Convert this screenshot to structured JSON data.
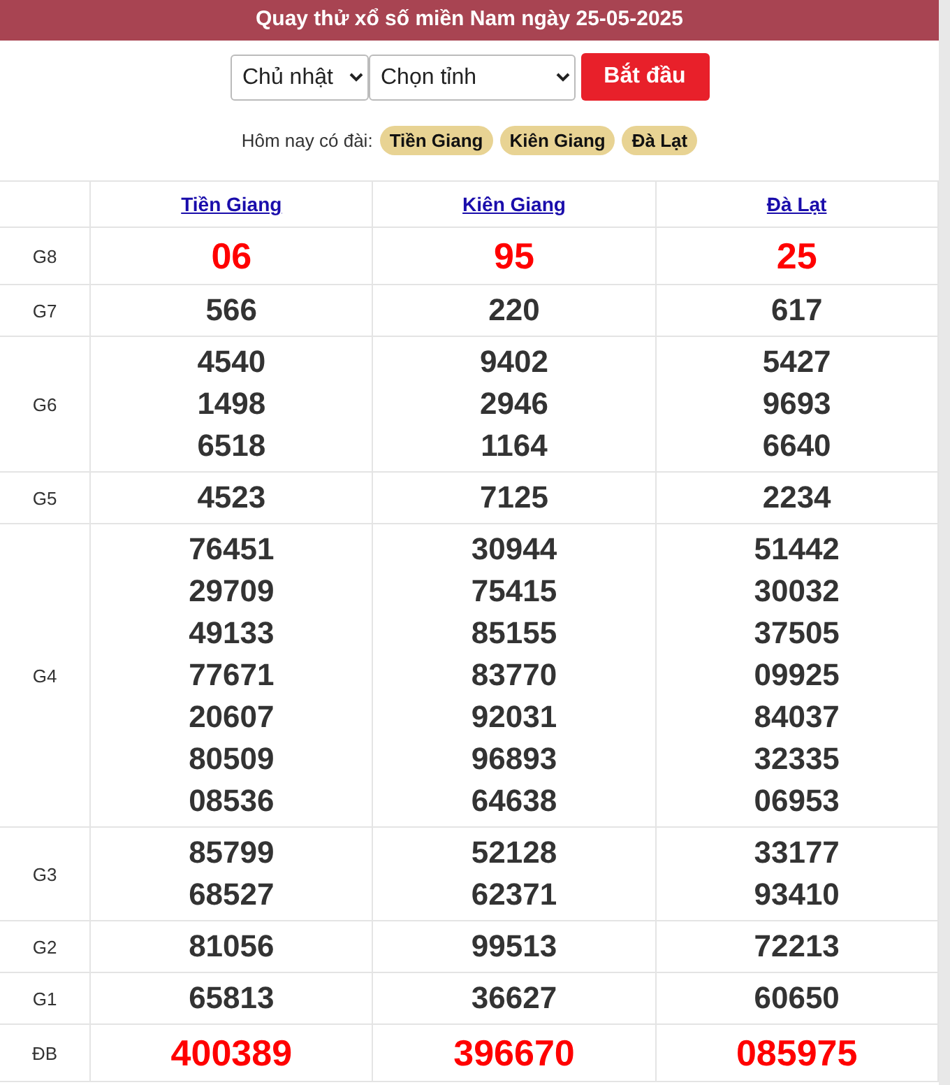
{
  "title": "Quay thử xổ số miền Nam ngày 25-05-2025",
  "controls": {
    "day": "Chủ nhật",
    "province": "Chọn tỉnh",
    "start_button": "Bắt đầu"
  },
  "today": {
    "label": "Hôm nay có đài:",
    "stations": [
      "Tiền Giang",
      "Kiên Giang",
      "Đà Lạt"
    ]
  },
  "table": {
    "columns": [
      "Tiền Giang",
      "Kiên Giang",
      "Đà Lạt"
    ],
    "rows": [
      {
        "prize": "G8",
        "highlight": true,
        "cells": [
          [
            "06"
          ],
          [
            "95"
          ],
          [
            "25"
          ]
        ]
      },
      {
        "prize": "G7",
        "highlight": false,
        "cells": [
          [
            "566"
          ],
          [
            "220"
          ],
          [
            "617"
          ]
        ]
      },
      {
        "prize": "G6",
        "highlight": false,
        "cells": [
          [
            "4540",
            "1498",
            "6518"
          ],
          [
            "9402",
            "2946",
            "1164"
          ],
          [
            "5427",
            "9693",
            "6640"
          ]
        ]
      },
      {
        "prize": "G5",
        "highlight": false,
        "cells": [
          [
            "4523"
          ],
          [
            "7125"
          ],
          [
            "2234"
          ]
        ]
      },
      {
        "prize": "G4",
        "highlight": false,
        "cells": [
          [
            "76451",
            "29709",
            "49133",
            "77671",
            "20607",
            "80509",
            "08536"
          ],
          [
            "30944",
            "75415",
            "85155",
            "83770",
            "92031",
            "96893",
            "64638"
          ],
          [
            "51442",
            "30032",
            "37505",
            "09925",
            "84037",
            "32335",
            "06953"
          ]
        ]
      },
      {
        "prize": "G3",
        "highlight": false,
        "cells": [
          [
            "85799",
            "68527"
          ],
          [
            "52128",
            "62371"
          ],
          [
            "33177",
            "93410"
          ]
        ]
      },
      {
        "prize": "G2",
        "highlight": false,
        "cells": [
          [
            "81056"
          ],
          [
            "99513"
          ],
          [
            "72213"
          ]
        ]
      },
      {
        "prize": "G1",
        "highlight": false,
        "cells": [
          [
            "65813"
          ],
          [
            "36627"
          ],
          [
            "60650"
          ]
        ]
      },
      {
        "prize": "ĐB",
        "highlight": true,
        "cells": [
          [
            "400389"
          ],
          [
            "396670"
          ],
          [
            "085975"
          ]
        ]
      }
    ]
  }
}
